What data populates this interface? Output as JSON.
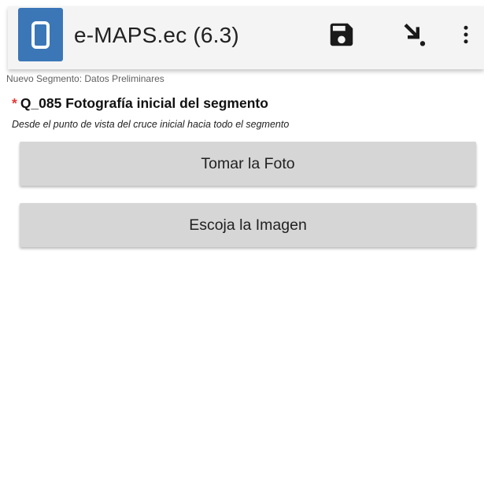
{
  "app": {
    "title": "e-MAPS.ec (6.3)",
    "logo_icon": "app-logo-icon",
    "accent": "#3b77b7"
  },
  "toolbar": {
    "save_icon": "save-icon",
    "download_icon": "download-arrow-icon",
    "more_icon": "more-vert-icon"
  },
  "form": {
    "header": "Nuevo Segmento: Datos Preliminares",
    "required_marker": "*",
    "required_color": "#e53935",
    "question": "Q_085 Fotografía inicial del segmento",
    "hint": "Desde el punto de vista del cruce inicial hacia todo el segmento",
    "take_photo_label": "Tomar la Foto",
    "choose_image_label": "Escoja la Imagen"
  }
}
